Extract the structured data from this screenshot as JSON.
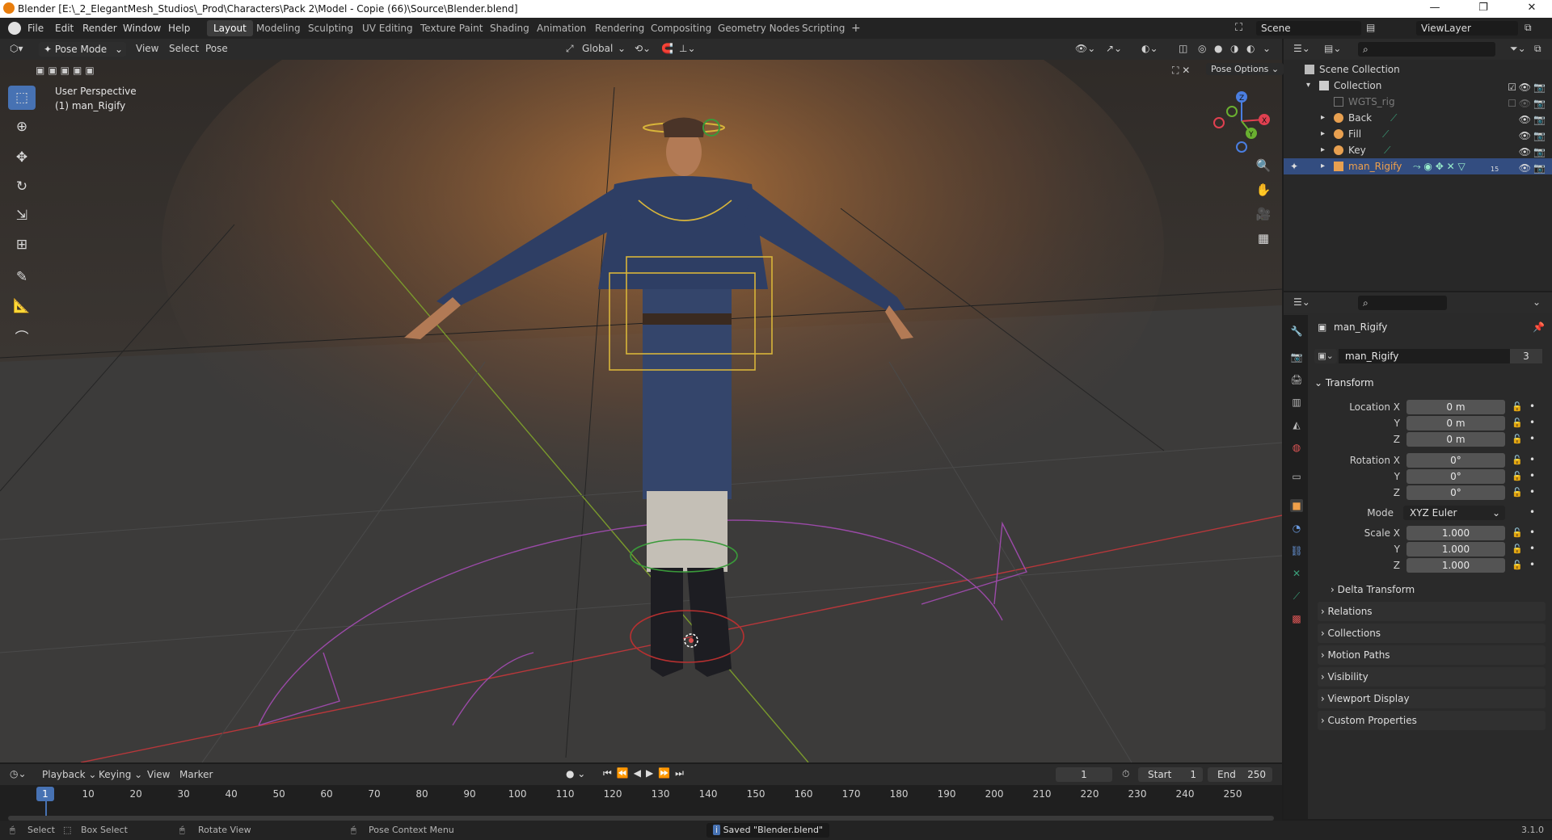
{
  "window": {
    "title": "Blender [E:\\_2_ElegantMesh_Studios\\_Prod\\Characters\\Pack 2\\Model - Copie (66)\\Source\\Blender.blend]",
    "minimize": "—",
    "maximize": "❐",
    "close": "✕"
  },
  "menubar": {
    "items": [
      "File",
      "Edit",
      "Render",
      "Window",
      "Help"
    ],
    "workspaces": [
      "Layout",
      "Modeling",
      "Sculpting",
      "UV Editing",
      "Texture Paint",
      "Shading",
      "Animation",
      "Rendering",
      "Compositing",
      "Geometry Nodes",
      "Scripting"
    ],
    "active_workspace": "Layout",
    "add_workspace": "+",
    "scene": "Scene",
    "view_layer": "ViewLayer"
  },
  "viewport_header": {
    "mode": "Pose Mode",
    "menus": [
      "View",
      "Select",
      "Pose"
    ],
    "orientation": "Global",
    "pose_options": "Pose Options"
  },
  "viewport": {
    "perspective": "User Perspective",
    "active_object": "(1) man_Rigify",
    "gizmo_axes": {
      "x": "X",
      "y": "Y",
      "z": "Z"
    }
  },
  "tools": [
    "select-box",
    "cursor",
    "move",
    "rotate",
    "scale",
    "transform",
    "annotate",
    "measure",
    "relax"
  ],
  "outliner": {
    "root": "Scene Collection",
    "collection": "Collection",
    "items": [
      {
        "name": "WGTS_rig",
        "dim": true
      },
      {
        "name": "Back",
        "dim": false
      },
      {
        "name": "Fill",
        "dim": false
      },
      {
        "name": "Key",
        "dim": false
      },
      {
        "name": "man_Rigify",
        "dim": false,
        "selected": true
      }
    ],
    "child_count": "15"
  },
  "properties": {
    "object_name": "man_Rigify",
    "datablock_name": "man_Rigify",
    "users": "3",
    "transform_header": "Transform",
    "location": {
      "label_x": "Location X",
      "x": "0 m",
      "y": "0 m",
      "z": "0 m"
    },
    "rotation": {
      "label_x": "Rotation X",
      "x": "0°",
      "y": "0°",
      "z": "0°"
    },
    "mode_label": "Mode",
    "mode_value": "XYZ Euler",
    "scale": {
      "label_x": "Scale X",
      "x": "1.000",
      "y": "1.000",
      "z": "1.000"
    },
    "axis_y": "Y",
    "axis_z": "Z",
    "subpanels": [
      "Delta Transform",
      "Relations",
      "Collections",
      "Motion Paths",
      "Visibility",
      "Viewport Display",
      "Custom Properties"
    ]
  },
  "timeline": {
    "menus": [
      "Playback",
      "Keying",
      "View",
      "Marker"
    ],
    "current_frame": "1",
    "start_label": "Start",
    "start": "1",
    "end_label": "End",
    "end": "250",
    "ruler": [
      "1",
      "10",
      "20",
      "30",
      "40",
      "50",
      "60",
      "70",
      "80",
      "90",
      "100",
      "110",
      "120",
      "130",
      "140",
      "150",
      "160",
      "170",
      "180",
      "190",
      "200",
      "210",
      "220",
      "230",
      "240",
      "250"
    ]
  },
  "status": {
    "select": "Select",
    "box_select": "Box Select",
    "rotate_view": "Rotate View",
    "context_menu": "Pose Context Menu",
    "message": "Saved \"Blender.blend\"",
    "version": "3.1.0"
  }
}
